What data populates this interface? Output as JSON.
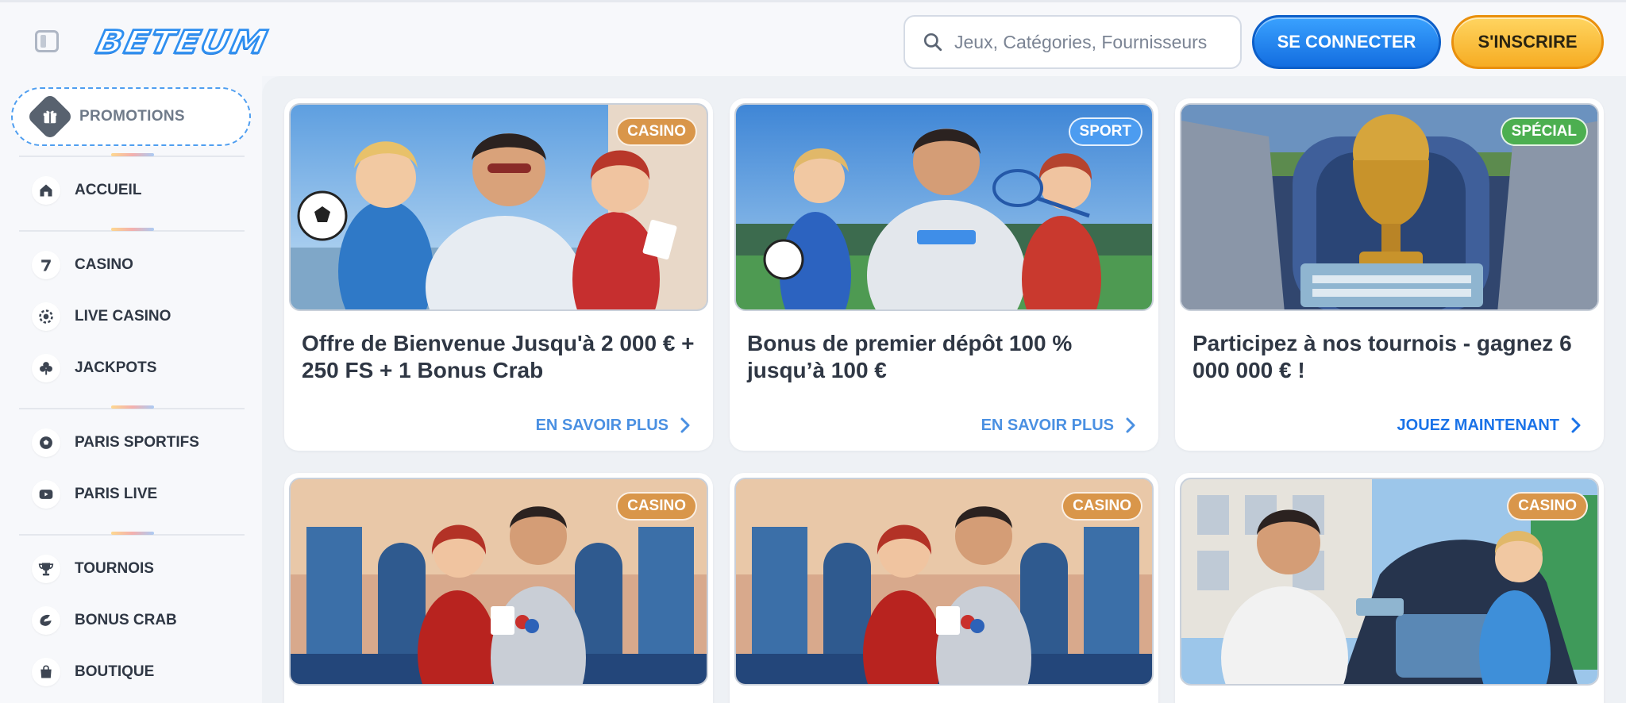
{
  "header": {
    "logo_text": "BETEUM",
    "search_placeholder": "Jeux, Catégories, Fournisseurs",
    "login_label": "SE CONNECTER",
    "register_label": "S'INSCRIRE"
  },
  "sidebar": {
    "promotions_label": "PROMOTIONS",
    "items": [
      {
        "label": "ACCUEIL",
        "icon": "home-icon"
      },
      {
        "label": "CASINO",
        "icon": "seven-icon"
      },
      {
        "label": "LIVE CASINO",
        "icon": "chip-icon"
      },
      {
        "label": "JACKPOTS",
        "icon": "clover-icon"
      },
      {
        "label": "PARIS SPORTIFS",
        "icon": "soccer-ball-icon"
      },
      {
        "label": "PARIS LIVE",
        "icon": "live-tv-icon"
      },
      {
        "label": "TOURNOIS",
        "icon": "trophy-icon"
      },
      {
        "label": "BONUS CRAB",
        "icon": "crab-claw-icon"
      },
      {
        "label": "BOUTIQUE",
        "icon": "shopping-bag-icon"
      }
    ]
  },
  "promotions": [
    {
      "badge": "CASINO",
      "title": "Offre de Bienvenue Jusqu'à 2 000 € + 250 FS + 1 Bonus Crab",
      "link": "EN SAVOIR PLUS"
    },
    {
      "badge": "SPORT",
      "title": "Bonus de premier dépôt 100 % jusqu’à 100 €",
      "link": "EN SAVOIR PLUS"
    },
    {
      "badge": "SPÉCIAL",
      "title": "Participez à nos tournois - gagnez 6 000 000 € !",
      "link": "JOUEZ MAINTENANT"
    },
    {
      "badge": "CASINO"
    },
    {
      "badge": "CASINO"
    },
    {
      "badge": "CASINO"
    }
  ],
  "colors": {
    "brand_blue": "#2f8ff0",
    "casino_badge": "#d9964a",
    "sport_badge": "#4c9cf0",
    "special_badge": "#4caf50",
    "link_muted_blue": "#4a90e2",
    "link_strong_blue": "#1a73e8"
  }
}
